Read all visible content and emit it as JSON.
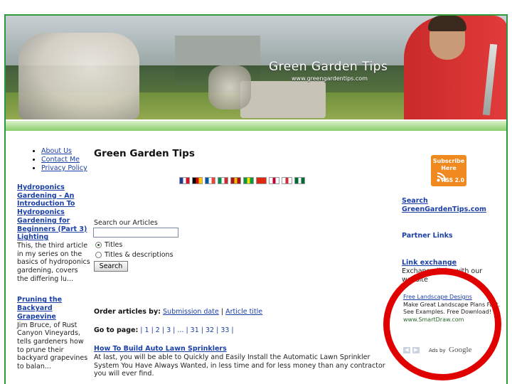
{
  "header": {
    "title": "Green Garden Tips",
    "url": "www.greengardentips.com"
  },
  "nav": {
    "items": [
      "About Us",
      "Contact Me",
      "Privacy Policy"
    ]
  },
  "sidebar_left": {
    "article1": {
      "title": "Hydroponics Gardening - An Introduction To Hydroponics Gardening for Beginners (Part 3) Lighting",
      "text": "This, the third article in my series on the basics of hydroponics gardening, covers the differing lu..."
    },
    "article2": {
      "title": "Pruning the Backyard Grapevine",
      "text": "Jim Bruce, of Rust Canyon Vineyards, tells gardeners how to prune their backyard grapevines to balan..."
    }
  },
  "main": {
    "title": "Green Garden Tips",
    "search_label": "Search our Articles",
    "search_value": "",
    "radio_titles": "Titles",
    "radio_titles_desc": "Titles & descriptions",
    "search_button": "Search",
    "order_label": "Order articles by:",
    "order_submission": "Submission date",
    "order_sep": "|",
    "order_title": "Article title",
    "goto_label": "Go to page:",
    "goto_pages": "| 1 | 2 | 3 | ... | 31 | 32 | 33 |",
    "article_title": "How To Build Auto Lawn Sprinklers",
    "article_text": "At last, you will be able to Quickly and Easily Install the Automatic Lawn Sprinkler System You Have Always Wanted, in less time and for less money than any contractor you will ever find."
  },
  "flags": [
    {
      "name": "uk-flag",
      "colors": [
        "#1c3f94",
        "#ffffff",
        "#cf142b"
      ]
    },
    {
      "name": "de-flag",
      "colors": [
        "#000000",
        "#dd0000",
        "#ffce00"
      ]
    },
    {
      "name": "fr-flag",
      "colors": [
        "#0055a4",
        "#ffffff",
        "#ef4135"
      ]
    },
    {
      "name": "it-flag",
      "colors": [
        "#009246",
        "#ffffff",
        "#ce2b37"
      ]
    },
    {
      "name": "es-flag",
      "colors": [
        "#aa151b",
        "#f1bf00",
        "#aa151b"
      ]
    },
    {
      "name": "br-flag",
      "colors": [
        "#009c3b",
        "#ffdf00",
        "#009c3b"
      ]
    },
    {
      "name": "cn-flag",
      "colors": [
        "#de2910",
        "#de2910",
        "#de2910"
      ]
    },
    {
      "name": "jp-flag",
      "colors": [
        "#ffffff",
        "#bc002d",
        "#ffffff"
      ]
    },
    {
      "name": "kr-flag",
      "colors": [
        "#ffffff",
        "#cd2e3a",
        "#ffffff"
      ]
    },
    {
      "name": "sa-flag",
      "colors": [
        "#006c35",
        "#ffffff",
        "#006c35"
      ]
    }
  ],
  "sidebar_right": {
    "rss_line1": "Subscribe",
    "rss_line2": "Here",
    "rss_version": "RSS 2.0",
    "search_label": "Search",
    "search_link": "GreenGardenTips.com",
    "partner_links": "Partner Links",
    "link_exchange_title": "Link exchange",
    "link_exchange_text": "Exchange links with our website"
  },
  "ad": {
    "headline": "Free Landscape Designs",
    "body": "Make Great Landscape Plans Fast. See Examples. Free Download!",
    "url": "www.SmartDraw.com",
    "ads_by": "Ads by",
    "google": "Google"
  },
  "colors": {
    "link": "#1a3fa6",
    "frame_green": "#2f9a3a",
    "highlight_circle": "#e00000",
    "rss_orange": "#f0891f"
  }
}
